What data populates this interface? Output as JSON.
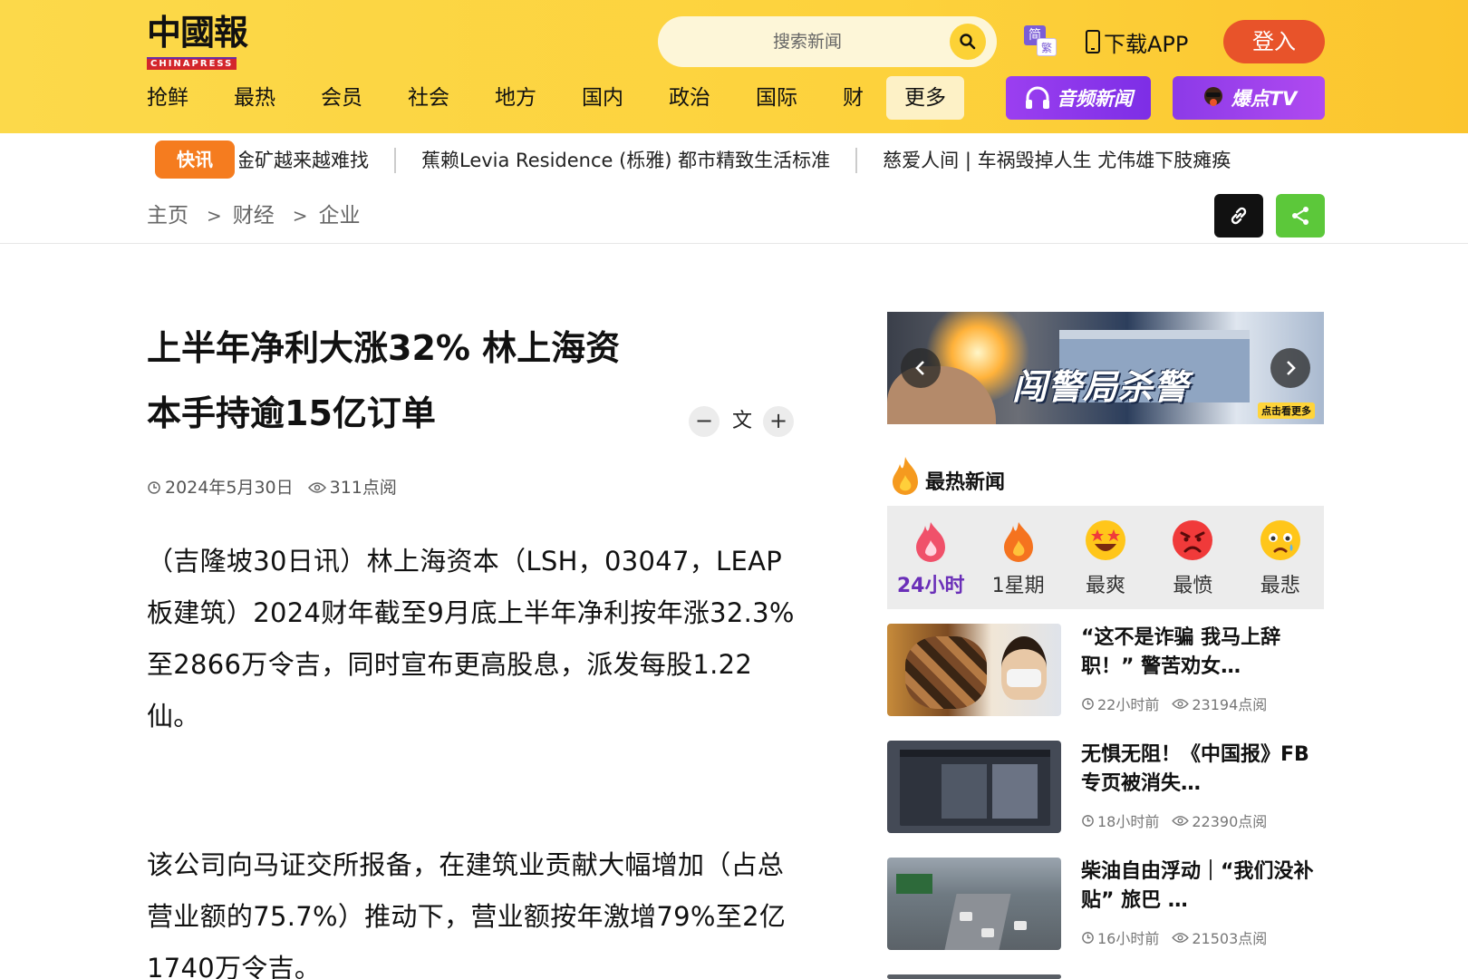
{
  "header": {
    "logo_cn": "中國報",
    "logo_en": "CHINAPRESS",
    "search_placeholder": "搜索新闻",
    "lang_a": "简",
    "lang_b": "繁",
    "download_label": "下载APP",
    "login_label": "登入",
    "nav": [
      "抢鲜",
      "最热",
      "会员",
      "社会",
      "地方",
      "国内",
      "政治",
      "国际",
      "财"
    ],
    "more_label": "更多",
    "audio_label": "音频新闻",
    "tv_label": "爆点TV",
    "brand_color": "#fcd94a",
    "login_color": "#e8532a"
  },
  "ticker": {
    "flash_label": "快讯",
    "items": [
      "金矿越来越难找",
      "蕉赖Levia Residence (栎雅) 都市精致生活标准",
      "慈爱人间 | 车祸毁掉人生 尤伟雄下肢瘫痪"
    ]
  },
  "breadcrumb": [
    "主页",
    "财经",
    "企业"
  ],
  "breadcrumb_sep": ">",
  "article": {
    "title_line1": "上半年净利大涨32% 林上海资",
    "title_line2": "本手持逾15亿订单",
    "font_minus": "−",
    "font_label": "文",
    "font_plus": "+",
    "date": "2024年5月30日",
    "views": "311点阅",
    "para1": "（吉隆坡30日讯）林上海资本（LSH，03047，LEAP板建筑）2024财年截至9月底上半年净利按年涨32.3%至2866万令吉，同时宣布更高股息，派发每股1.22仙。",
    "para2": "该公司向马证交所报备，在建筑业贡献大幅增加（占总营业额的75.7%）推动下，营业额按年激增79%至2亿1740万令吉。"
  },
  "sidebar": {
    "banner_headline": "闯警局杀警",
    "banner_cta": "点击看更多",
    "hot_title": "最热新闻",
    "moods": [
      "24小时",
      "1星期",
      "最爽",
      "最愤",
      "最悲"
    ],
    "active_mood": "24小时",
    "news": [
      {
        "title": "“这不是诈骗 我马上辞职！” 警苦劝女…",
        "time": "22小时前",
        "views": "23194点阅"
      },
      {
        "title": "无惧无阻！《中国报》FB专页被消失…",
        "time": "18小时前",
        "views": "22390点阅"
      },
      {
        "title": "柴油自由浮动｜“我们没补贴” 旅巴 …",
        "time": "16小时前",
        "views": "21503点阅"
      }
    ]
  }
}
